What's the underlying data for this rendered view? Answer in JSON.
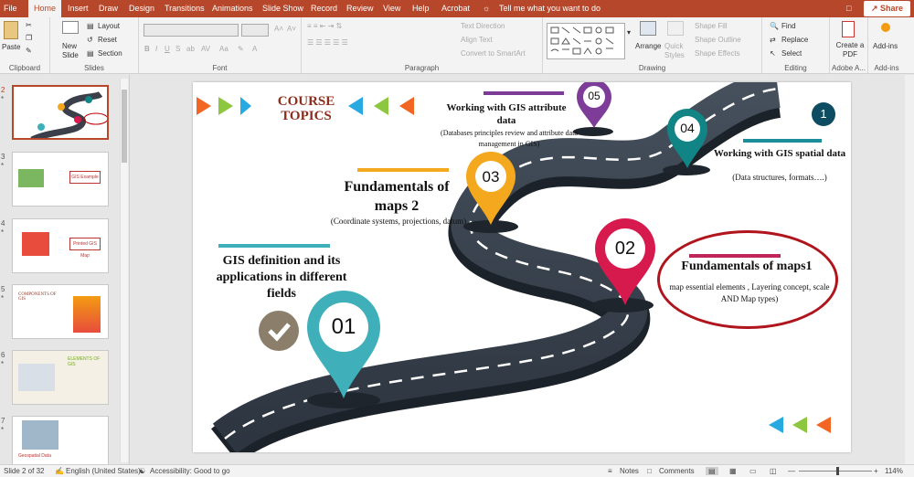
{
  "tabs": [
    "File",
    "Home",
    "Insert",
    "Draw",
    "Design",
    "Transitions",
    "Animations",
    "Slide Show",
    "Record",
    "Review",
    "View",
    "Help",
    "Acrobat"
  ],
  "active_tab": "Home",
  "tell_me": "Tell me what you want to do",
  "share_label": "Share",
  "ribbon": {
    "clipboard": {
      "paste": "Paste",
      "label": "Clipboard"
    },
    "slides": {
      "new_slide": "New Slide",
      "layout": "Layout",
      "reset": "Reset",
      "section": "Section",
      "label": "Slides"
    },
    "font": {
      "label": "Font"
    },
    "paragraph": {
      "text_direction": "Text Direction",
      "align_text": "Align Text",
      "convert_smartart": "Convert to SmartArt",
      "label": "Paragraph"
    },
    "drawing": {
      "arrange": "Arrange",
      "quick_styles": "Quick Styles",
      "shape_fill": "Shape Fill",
      "shape_outline": "Shape Outline",
      "shape_effects": "Shape Effects",
      "label": "Drawing"
    },
    "editing": {
      "find": "Find",
      "replace": "Replace",
      "select": "Select",
      "label": "Editing"
    },
    "adobe": {
      "create_pdf": "Create a PDF",
      "label": "Adobe A..."
    },
    "addins": {
      "addins": "Add-ins",
      "label": "Add-ins"
    }
  },
  "thumbnails": [
    {
      "num": "2",
      "star": "*"
    },
    {
      "num": "3",
      "star": "*",
      "caption": "GIS Example"
    },
    {
      "num": "4",
      "star": "*",
      "caption": "Printed GIS Map"
    },
    {
      "num": "5",
      "star": "*",
      "caption": "COMPONENTS OF GIS"
    },
    {
      "num": "6",
      "star": "*",
      "caption": "ELEMENTS OF GIS"
    },
    {
      "num": "7",
      "star": "*",
      "caption": "Geospatial Data"
    }
  ],
  "slide": {
    "course_topics": "COURSE TOPICS",
    "badge_number": "1",
    "topics": [
      {
        "num": "01",
        "title": "GIS definition and its applications in different fields",
        "color": "#3fb0ba"
      },
      {
        "num": "02",
        "title": "Fundamentals of maps1",
        "detail": "map essential elements , Layering concept, scale AND Map types)",
        "color": "#d61a4d"
      },
      {
        "num": "03",
        "title": "Fundamentals of maps 2",
        "detail": "(Coordinate systems, projections, datum)",
        "color": "#f4a81d"
      },
      {
        "num": "04",
        "title": "Working with GIS spatial data",
        "detail": "(Data structures, formats….)",
        "color": "#118486"
      },
      {
        "num": "05",
        "title": "Working with GIS attribute data",
        "detail": "(Databases principles review and attribute data management in GIS)",
        "color": "#6a2c91"
      }
    ]
  },
  "status": {
    "slide_info": "Slide 2 of 32",
    "language": "English (United States)",
    "accessibility": "Accessibility: Good to go",
    "notes": "Notes",
    "comments": "Comments",
    "zoom": "114%"
  }
}
